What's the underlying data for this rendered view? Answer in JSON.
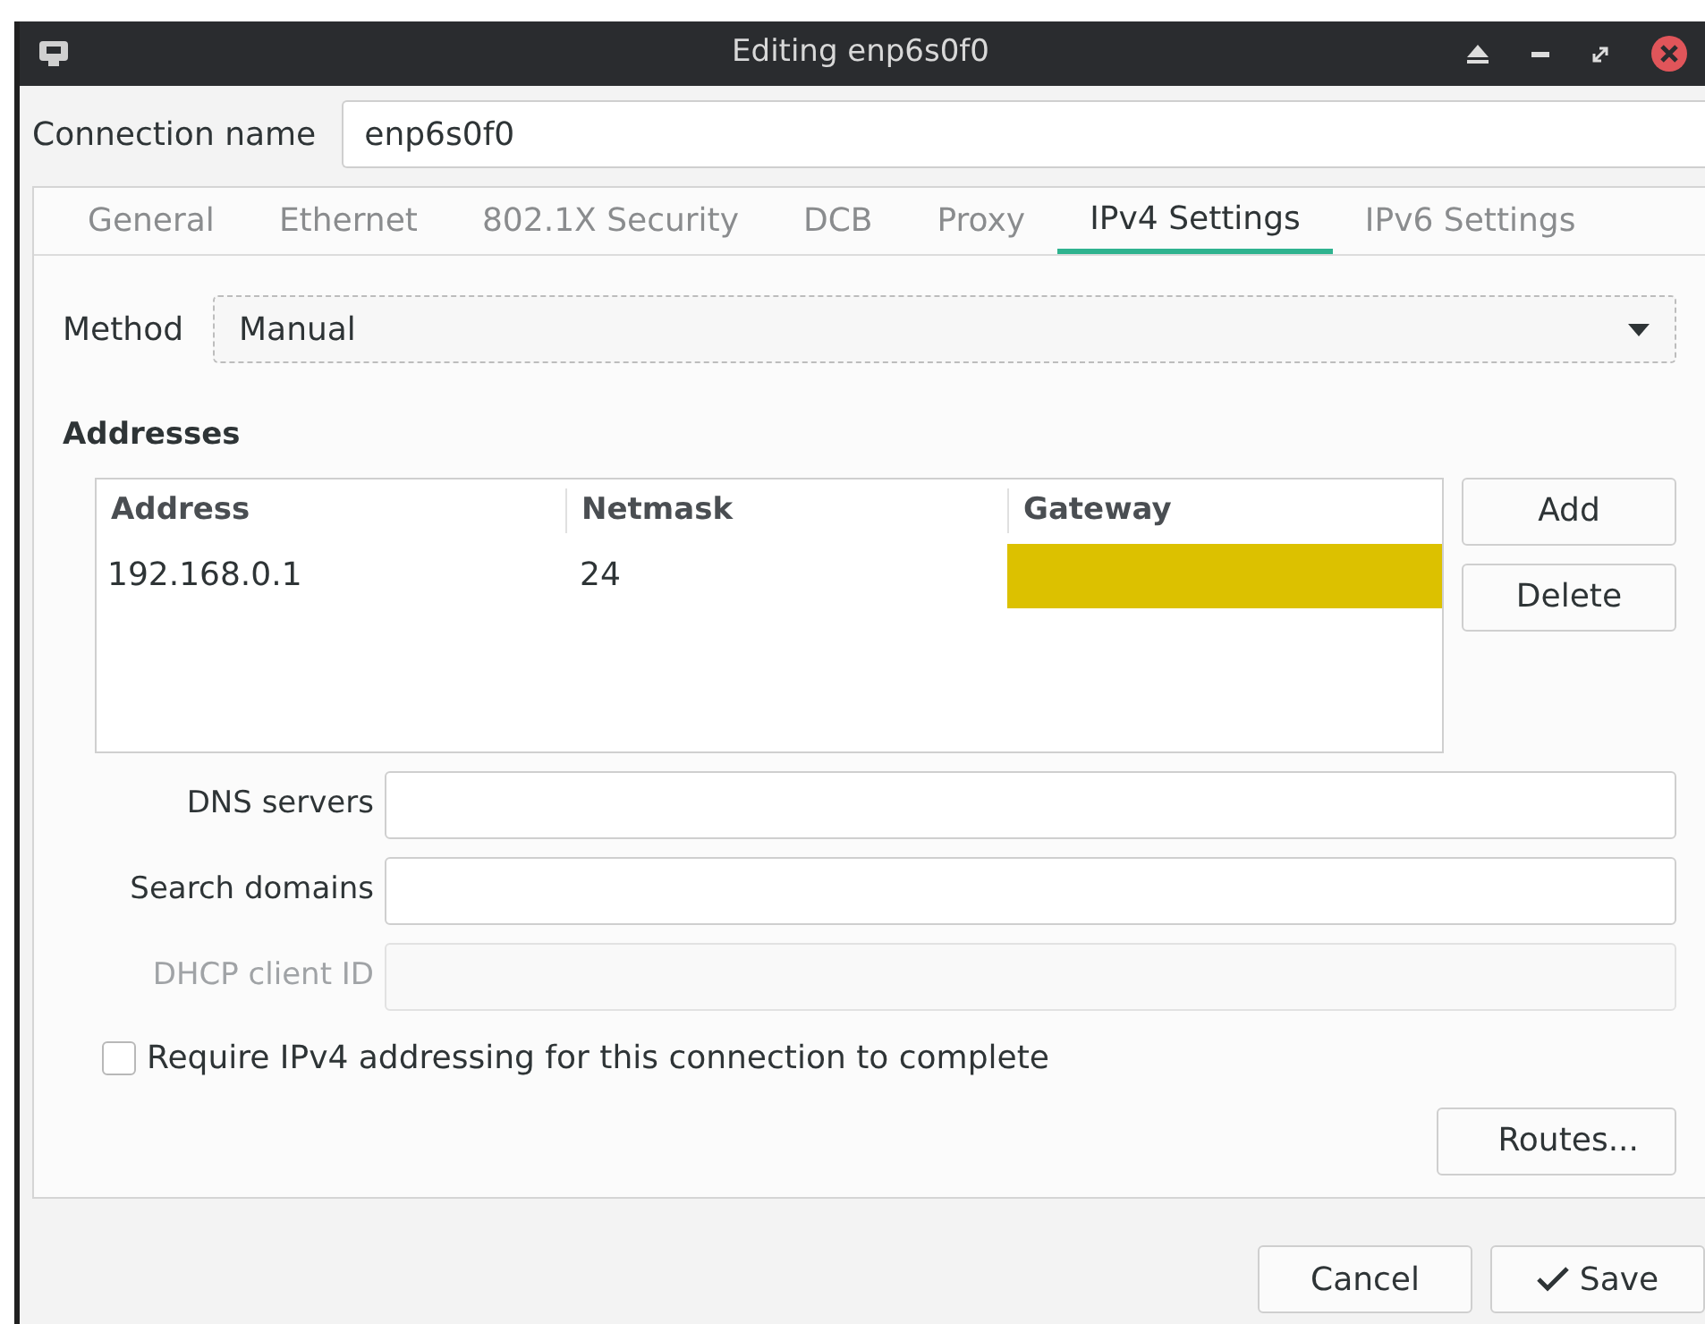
{
  "window": {
    "title": "Editing enp6s0f0"
  },
  "connection_name": {
    "label": "Connection name",
    "value": "enp6s0f0"
  },
  "tabs": [
    {
      "label": "General",
      "selected": false
    },
    {
      "label": "Ethernet",
      "selected": false
    },
    {
      "label": "802.1X Security",
      "selected": false
    },
    {
      "label": "DCB",
      "selected": false
    },
    {
      "label": "Proxy",
      "selected": false
    },
    {
      "label": "IPv4 Settings",
      "selected": true
    },
    {
      "label": "IPv6 Settings",
      "selected": false
    }
  ],
  "method": {
    "label": "Method",
    "value": "Manual"
  },
  "addresses": {
    "heading": "Addresses",
    "columns": [
      "Address",
      "Netmask",
      "Gateway"
    ],
    "rows": [
      {
        "address": "192.168.0.1",
        "netmask": "24",
        "gateway_editing": true
      }
    ],
    "buttons": [
      "Add",
      "Delete"
    ]
  },
  "fields": [
    {
      "label": "DNS servers",
      "disabled": false
    },
    {
      "label": "Search domains",
      "disabled": false
    },
    {
      "label": "DHCP client ID",
      "disabled": true
    }
  ],
  "require_checkbox": {
    "label": "Require IPv4 addressing for this connection to complete",
    "checked": false
  },
  "routes_button": "Routes...",
  "dialog_buttons": [
    {
      "label": "Cancel",
      "kind": "plain"
    },
    {
      "label": "Save",
      "kind": "confirm"
    }
  ]
}
